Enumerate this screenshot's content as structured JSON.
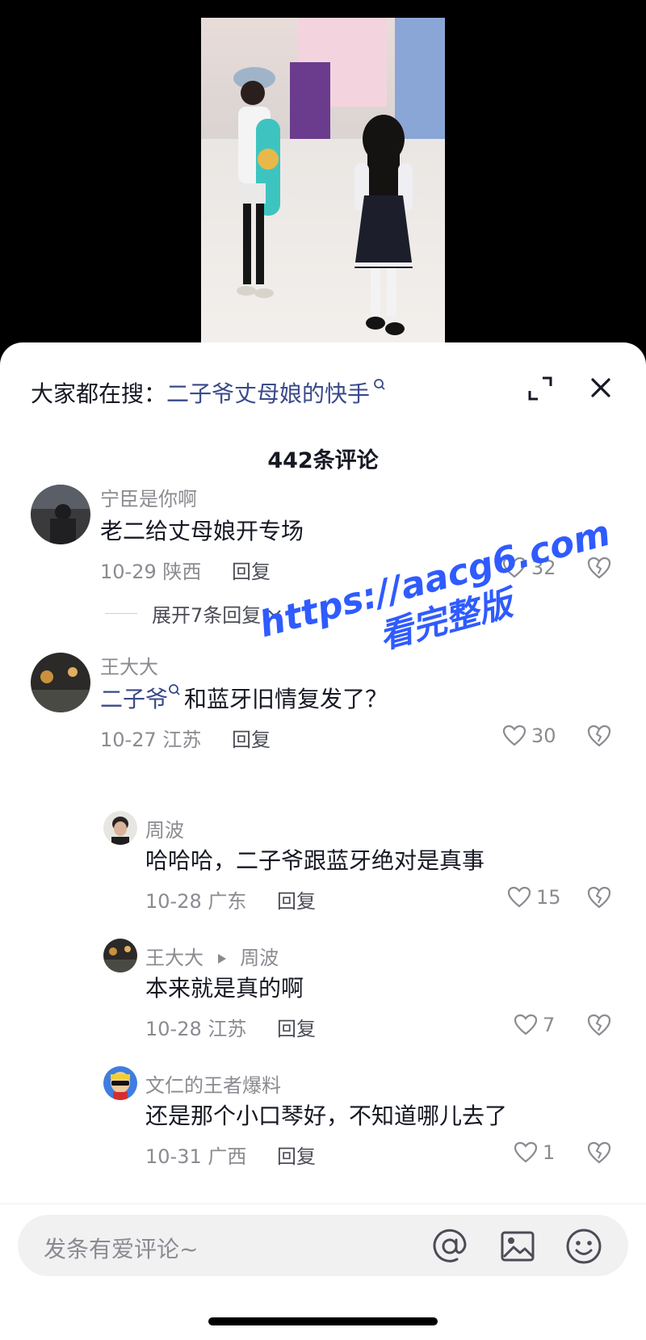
{
  "search_bar": {
    "prefix": "大家都在搜：",
    "keyword": "二子爷丈母娘的快手"
  },
  "comments_count": "442条评论",
  "comments": [
    {
      "user": "宁臣是你啊",
      "text": "老二给丈母娘开专场",
      "date": "10-29",
      "location": "陕西",
      "reply_label": "回复",
      "likes": "32",
      "expand_label": "展开7条回复"
    },
    {
      "user": "王大大",
      "mention": "二子爷",
      "text": "和蓝牙旧情复发了？",
      "date": "10-27",
      "location": "江苏",
      "reply_label": "回复",
      "likes": "30"
    }
  ],
  "replies": [
    {
      "user": "周波",
      "text": "哈哈哈，二子爷跟蓝牙绝对是真事",
      "date": "10-28",
      "location": "广东",
      "reply_label": "回复",
      "likes": "15"
    },
    {
      "user": "王大大",
      "reply_to": "周波",
      "text": "本来就是真的啊",
      "date": "10-28",
      "location": "江苏",
      "reply_label": "回复",
      "likes": "7"
    },
    {
      "user": "文仁的王者爆料",
      "text": "还是那个小口琴好，不知道哪儿去了",
      "date": "10-31",
      "location": "广西",
      "reply_label": "回复",
      "likes": "1"
    }
  ],
  "watermark": {
    "line1": "https://aacg6.com",
    "line2": "看完整版"
  },
  "input": {
    "placeholder": "发条有爱评论~"
  },
  "colors": {
    "mention": "#3a4a8a",
    "watermark": "#2f5bff",
    "secondary_text": "#8a8b91"
  }
}
